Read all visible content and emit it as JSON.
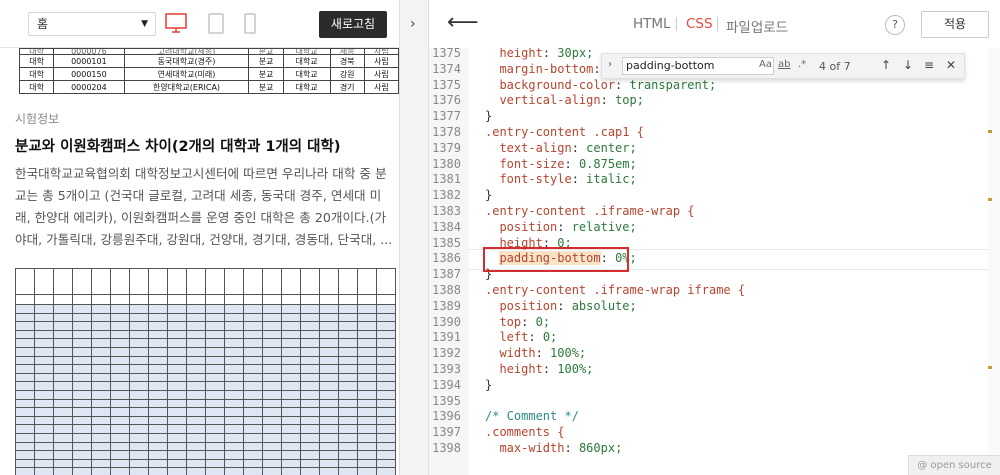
{
  "preview_toolbar": {
    "select_value": "홈",
    "refresh_label": "새로고침"
  },
  "article": {
    "top_table": [
      [
        "대학",
        "0000101",
        "동국대학교(경주)",
        "분교",
        "대학교",
        "경북",
        "사립"
      ],
      [
        "대학",
        "0000150",
        "연세대학교(미래)",
        "분교",
        "대학교",
        "강원",
        "사립"
      ],
      [
        "대학",
        "0000204",
        "한양대학교(ERICA)",
        "분교",
        "대학교",
        "경기",
        "사립"
      ]
    ],
    "category": "시험정보",
    "title": "분교와 이원화캠퍼스 차이(2개의 대학과 1개의 대학)",
    "body": "한국대학교교육협의회 대학정보고시센터에 따르면 우리나라 대학 중 분교는 총 5개이고 (건국대 글로컬, 고려대 세종, 동국대 경주, 연세대 미래, 한양대 에리카), 이원화캠퍼스를 운영 중인 대학은 총 20개이다.(가야대, 가톨릭대, 강릉원주대, 강원대, 건양대, 경기대, 경동대, 단국대, ..."
  },
  "editor": {
    "tabs": {
      "html": "HTML",
      "css": "CSS",
      "upload": "파일업로드"
    },
    "help": "?",
    "apply": "적용",
    "find": {
      "query": "padding-bottom",
      "case_option": "Aa",
      "word_option": "ab",
      "regex_option": ".*",
      "count": "4 of 7"
    },
    "lines": [
      {
        "n": "1375",
        "text": "    height: 30px;"
      },
      {
        "n": "1374",
        "text": "    margin-bottom: 1"
      },
      {
        "n": "1375",
        "text": "    background-color: transparent;"
      },
      {
        "n": "1376",
        "text": "    vertical-align: top;"
      },
      {
        "n": "1377",
        "text": "}"
      },
      {
        "n": "1378",
        "text": ".entry-content .cap1 {"
      },
      {
        "n": "1379",
        "text": "    text-align: center;"
      },
      {
        "n": "1380",
        "text": "    font-size: 0.875em;"
      },
      {
        "n": "1381",
        "text": "    font-style: italic;"
      },
      {
        "n": "1382",
        "text": "}"
      },
      {
        "n": "1383",
        "text": ".entry-content .iframe-wrap {"
      },
      {
        "n": "1384",
        "text": "    position: relative;"
      },
      {
        "n": "1385",
        "text": "    height: 0;"
      },
      {
        "n": "1386",
        "text": "    padding-bottom: 0%;"
      },
      {
        "n": "1387",
        "text": "}"
      },
      {
        "n": "1388",
        "text": ".entry-content .iframe-wrap iframe {"
      },
      {
        "n": "1389",
        "text": "    position: absolute;"
      },
      {
        "n": "1390",
        "text": "    top: 0;"
      },
      {
        "n": "1391",
        "text": "    left: 0;"
      },
      {
        "n": "1392",
        "text": "    width: 100%;"
      },
      {
        "n": "1393",
        "text": "    height: 100%;"
      },
      {
        "n": "1394",
        "text": "}"
      },
      {
        "n": "1395",
        "text": ""
      },
      {
        "n": "1396",
        "text": "/* Comment */"
      },
      {
        "n": "1397",
        "text": ".comments {"
      },
      {
        "n": "1398",
        "text": "    max-width: 860px;"
      }
    ],
    "open_source": "@ open source",
    "colors": {
      "tab_active": "#e8483f",
      "selector": "#b5452e",
      "value": "#2c7a3c",
      "comment": "#2e8a8a",
      "highlight_box": "#d42d2d"
    }
  }
}
